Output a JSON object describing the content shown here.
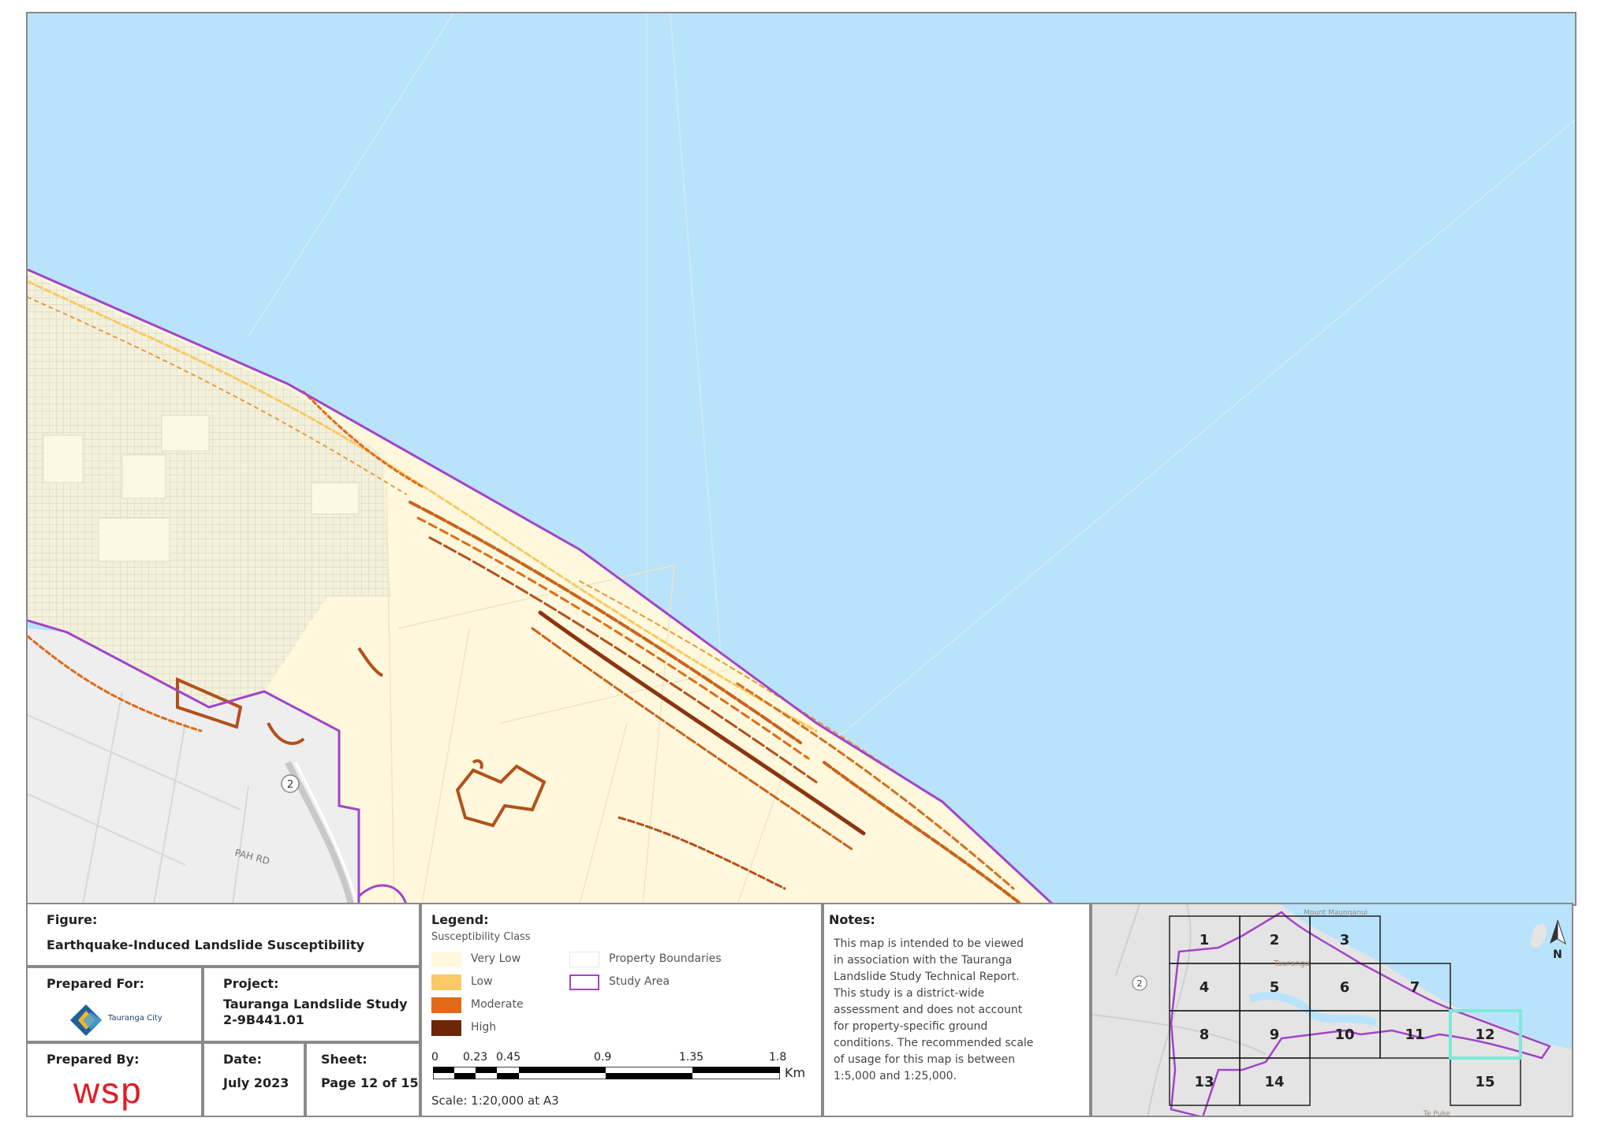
{
  "figure": {
    "label": "Figure:",
    "title": "Earthquake-Induced Landslide Susceptibility"
  },
  "prepared_for": {
    "label": "Prepared For:",
    "logo_text": "Tauranga City"
  },
  "project": {
    "label": "Project:",
    "name": "Tauranga Landslide Study",
    "number": "2-9B441.01"
  },
  "prepared_by": {
    "label": "Prepared By:",
    "logo_text": "wsp"
  },
  "date": {
    "label": "Date:",
    "value": "July 2023"
  },
  "sheet": {
    "label": "Sheet:",
    "value": "Page 12 of 15"
  },
  "legend": {
    "title": "Legend:",
    "subtitle": "Susceptibility Class",
    "classes": [
      {
        "label": "Very Low",
        "color": "#fff8dc"
      },
      {
        "label": "Low",
        "color": "#fac864"
      },
      {
        "label": "Moderate",
        "color": "#e06a18"
      },
      {
        "label": "High",
        "color": "#6e2508"
      }
    ],
    "other": [
      {
        "label": "Property Boundaries",
        "color": "#e6e6e6"
      },
      {
        "label": "Study Area",
        "color": "#a244c8"
      }
    ]
  },
  "scale": {
    "ticks": [
      "0",
      "0.23",
      "0.45",
      "0.9",
      "1.35",
      "1.8"
    ],
    "unit": "Km",
    "text": "Scale: 1:20,000 at A3"
  },
  "notes": {
    "title": "Notes:",
    "lines": [
      "This map is intended to be viewed",
      "in association with the Tauranga",
      "Landslide Study Technical Report.",
      "This study is a district-wide",
      "assessment and does not account",
      "for property-specific ground",
      "conditions. The recommended scale",
      "of usage for this map is between",
      "1:5,000 and 1:25,000."
    ]
  },
  "map_labels": {
    "road_shield": "2",
    "road_name": "PAH RD"
  },
  "index_map": {
    "sheets": [
      "1",
      "2",
      "3",
      "4",
      "5",
      "6",
      "7",
      "8",
      "9",
      "10",
      "11",
      "12",
      "13",
      "14",
      "15"
    ],
    "current": "12",
    "place_labels": [
      "Mount Maunganui",
      "Tauranga",
      "Te Puke"
    ],
    "shield": "2",
    "north": "N"
  },
  "colors": {
    "sea": "#b9e3fb",
    "study_area": "#a244c8",
    "highlight": "#7fe8d8"
  }
}
